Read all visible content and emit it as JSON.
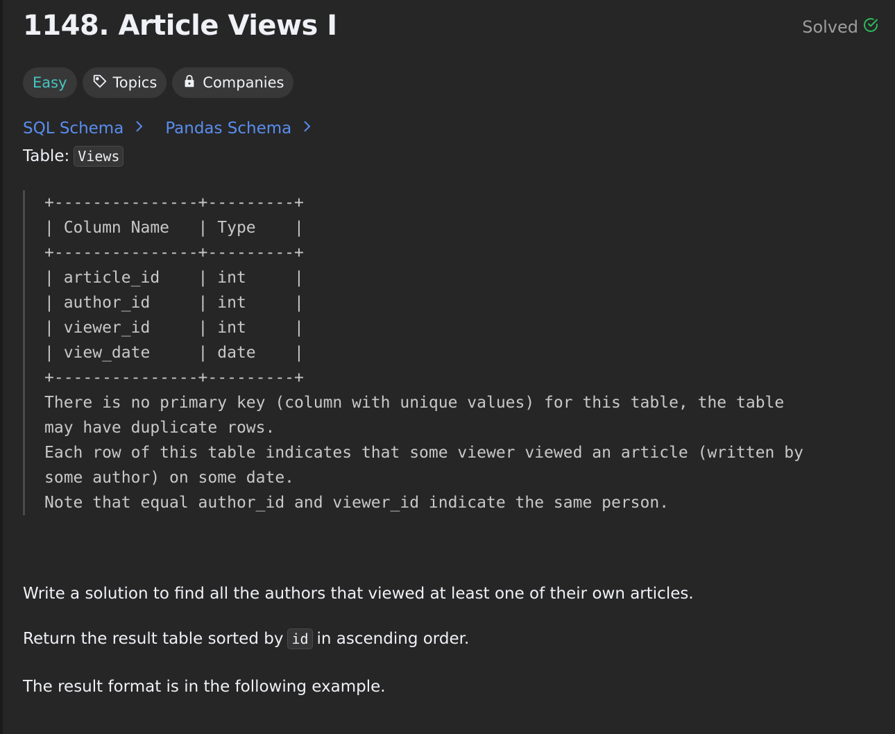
{
  "problem": {
    "title": "1148. Article Views I",
    "status": "Solved",
    "status_color": "#2cbb5d"
  },
  "tags": {
    "difficulty": "Easy",
    "topics": "Topics",
    "companies": "Companies"
  },
  "schema_links": {
    "sql": "SQL Schema",
    "pandas": "Pandas Schema"
  },
  "table": {
    "label": "Table:",
    "name": "Views"
  },
  "schema_block": {
    "lines": [
      "+---------------+---------+",
      "| Column Name   | Type    |",
      "+---------------+---------+",
      "| article_id    | int     |",
      "| author_id     | int     |",
      "| viewer_id     | int     |",
      "| view_date     | date    |",
      "+---------------+---------+",
      "There is no primary key (column with unique values) for this table, the table",
      "may have duplicate rows.",
      "Each row of this table indicates that some viewer viewed an article (written by",
      "some author) on some date.",
      "Note that equal author_id and viewer_id indicate the same person."
    ]
  },
  "description": {
    "p1": "Write a solution to find all the authors that viewed at least one of their own articles.",
    "p2_before": "Return the result table sorted by",
    "p2_code": "id",
    "p2_after": "in ascending order.",
    "p3": "The result format is in the following example."
  }
}
